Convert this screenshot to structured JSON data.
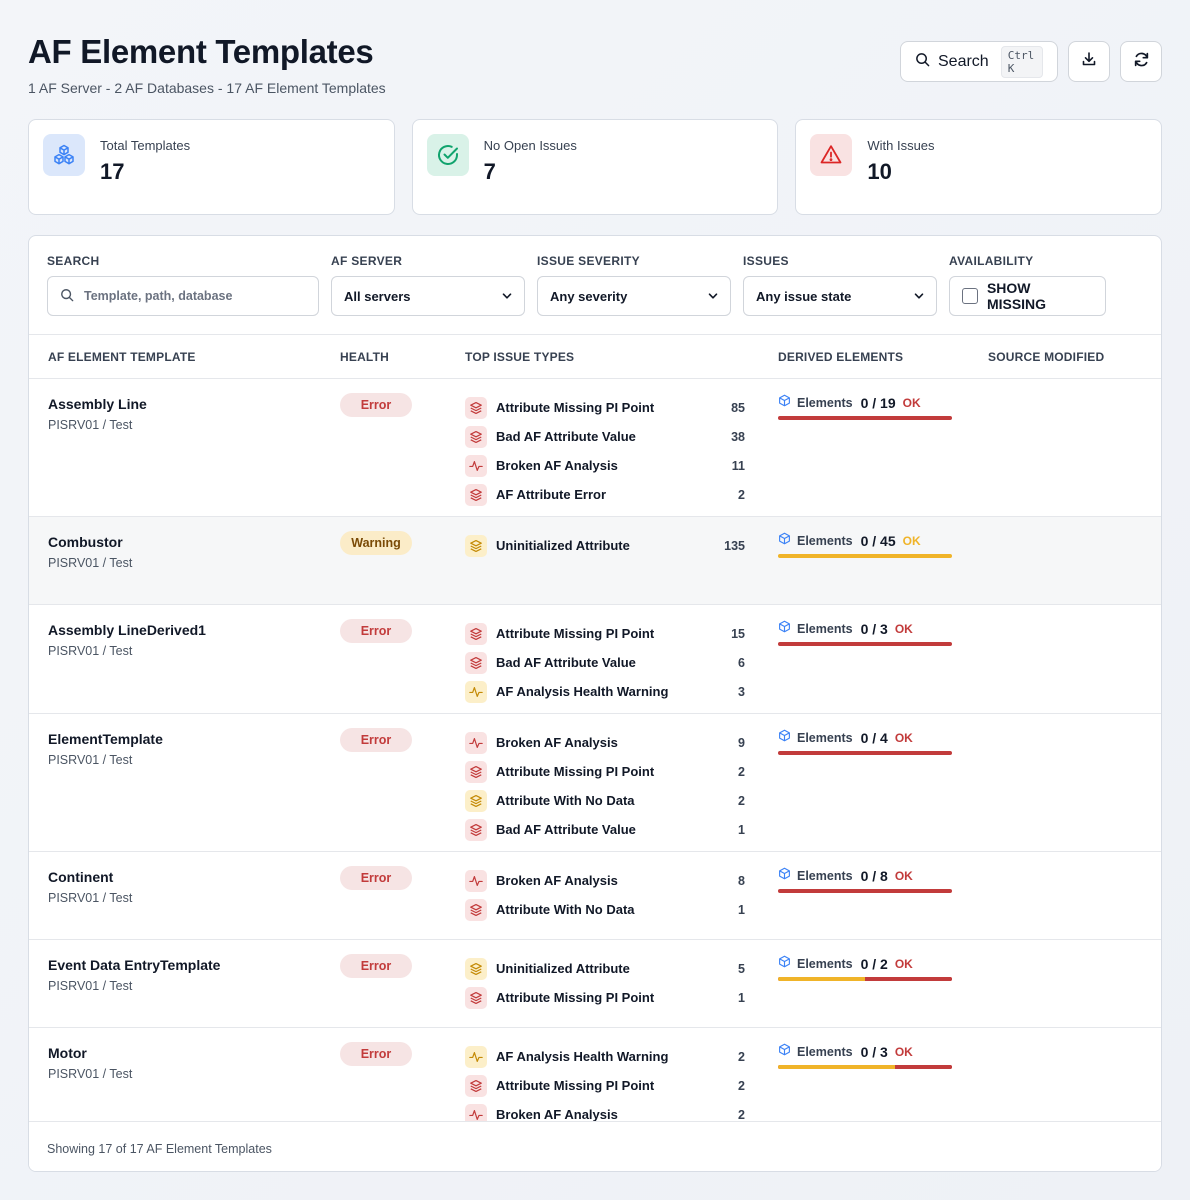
{
  "header": {
    "title": "AF Element Templates",
    "subtitle": "1 AF Server - 2 AF Databases - 17 AF Element Templates",
    "search_label": "Search",
    "search_shortcut": "Ctrl K"
  },
  "stats": [
    {
      "label": "Total Templates",
      "value": "17",
      "icon": "cubes-icon",
      "color": "#3b82f6"
    },
    {
      "label": "No Open Issues",
      "value": "7",
      "icon": "check-circle-icon",
      "color": "#10b981"
    },
    {
      "label": "With Issues",
      "value": "10",
      "icon": "warning-triangle-icon",
      "color": "#dc2626"
    }
  ],
  "filters": {
    "search_label": "SEARCH",
    "search_placeholder": "Template, path, database",
    "server_label": "AF SERVER",
    "server_value": "All servers",
    "severity_label": "ISSUE SEVERITY",
    "severity_value": "Any severity",
    "issues_label": "ISSUES",
    "issues_value": "Any issue state",
    "availability_label": "AVAILABILITY",
    "show_missing_label": "SHOW MISSING"
  },
  "columns": {
    "template": "AF ELEMENT TEMPLATE",
    "health": "HEALTH",
    "top_issues": "TOP ISSUE TYPES",
    "derived": "DERIVED ELEMENTS",
    "modified": "SOURCE MODIFIED"
  },
  "rows": [
    {
      "name": "Assembly Line",
      "path": "PISRV01 / Test",
      "health": "Error",
      "health_type": "error",
      "issues": [
        {
          "label": "Attribute Missing PI Point",
          "count": "85",
          "icon": "layers-icon",
          "tone": "red"
        },
        {
          "label": "Bad AF Attribute Value",
          "count": "38",
          "icon": "layers-icon",
          "tone": "red"
        },
        {
          "label": "Broken AF Analysis",
          "count": "11",
          "icon": "pulse-icon",
          "tone": "red"
        },
        {
          "label": "AF Attribute Error",
          "count": "2",
          "icon": "layers-icon",
          "tone": "red"
        }
      ],
      "derived": {
        "label": "Elements",
        "count": "0 / 19",
        "status": "OK",
        "tone": "red",
        "amber_fraction": 0
      }
    },
    {
      "name": "Combustor",
      "path": "PISRV01 / Test",
      "health": "Warning",
      "health_type": "warning",
      "issues": [
        {
          "label": "Uninitialized Attribute",
          "count": "135",
          "icon": "layers-icon",
          "tone": "amber"
        }
      ],
      "derived": {
        "label": "Elements",
        "count": "0 / 45",
        "status": "OK",
        "tone": "amber",
        "amber_fraction": 1
      }
    },
    {
      "name": "Assembly LineDerived1",
      "path": "PISRV01 / Test",
      "health": "Error",
      "health_type": "error",
      "issues": [
        {
          "label": "Attribute Missing PI Point",
          "count": "15",
          "icon": "layers-icon",
          "tone": "red"
        },
        {
          "label": "Bad AF Attribute Value",
          "count": "6",
          "icon": "layers-icon",
          "tone": "red"
        },
        {
          "label": "AF Analysis Health Warning",
          "count": "3",
          "icon": "pulse-icon",
          "tone": "amber"
        }
      ],
      "derived": {
        "label": "Elements",
        "count": "0 / 3",
        "status": "OK",
        "tone": "red",
        "amber_fraction": 0
      }
    },
    {
      "name": "ElementTemplate",
      "path": "PISRV01 / Test",
      "health": "Error",
      "health_type": "error",
      "issues": [
        {
          "label": "Broken AF Analysis",
          "count": "9",
          "icon": "pulse-icon",
          "tone": "red"
        },
        {
          "label": "Attribute Missing PI Point",
          "count": "2",
          "icon": "layers-icon",
          "tone": "red"
        },
        {
          "label": "Attribute With No Data",
          "count": "2",
          "icon": "layers-icon",
          "tone": "amber"
        },
        {
          "label": "Bad AF Attribute Value",
          "count": "1",
          "icon": "layers-icon",
          "tone": "red"
        }
      ],
      "derived": {
        "label": "Elements",
        "count": "0 / 4",
        "status": "OK",
        "tone": "red",
        "amber_fraction": 0
      }
    },
    {
      "name": "Continent",
      "path": "PISRV01 / Test",
      "health": "Error",
      "health_type": "error",
      "issues": [
        {
          "label": "Broken AF Analysis",
          "count": "8",
          "icon": "pulse-icon",
          "tone": "red"
        },
        {
          "label": "Attribute With No Data",
          "count": "1",
          "icon": "layers-icon",
          "tone": "red"
        }
      ],
      "derived": {
        "label": "Elements",
        "count": "0 / 8",
        "status": "OK",
        "tone": "red",
        "amber_fraction": 0
      }
    },
    {
      "name": "Event Data EntryTemplate",
      "path": "PISRV01 / Test",
      "health": "Error",
      "health_type": "error",
      "issues": [
        {
          "label": "Uninitialized Attribute",
          "count": "5",
          "icon": "layers-icon",
          "tone": "amber"
        },
        {
          "label": "Attribute Missing PI Point",
          "count": "1",
          "icon": "layers-icon",
          "tone": "red"
        }
      ],
      "derived": {
        "label": "Elements",
        "count": "0 / 2",
        "status": "OK",
        "tone": "red",
        "amber_fraction": 0.5
      }
    },
    {
      "name": "Motor",
      "path": "PISRV01 / Test",
      "health": "Error",
      "health_type": "error",
      "issues": [
        {
          "label": "AF Analysis Health Warning",
          "count": "2",
          "icon": "pulse-icon",
          "tone": "amber"
        },
        {
          "label": "Attribute Missing PI Point",
          "count": "2",
          "icon": "layers-icon",
          "tone": "red"
        },
        {
          "label": "Broken AF Analysis",
          "count": "2",
          "icon": "pulse-icon",
          "tone": "red"
        }
      ],
      "derived": {
        "label": "Elements",
        "count": "0 / 3",
        "status": "OK",
        "tone": "red",
        "amber_fraction": 0.667
      }
    }
  ],
  "footer": {
    "text": "Showing 17 of 17 AF Element Templates"
  }
}
